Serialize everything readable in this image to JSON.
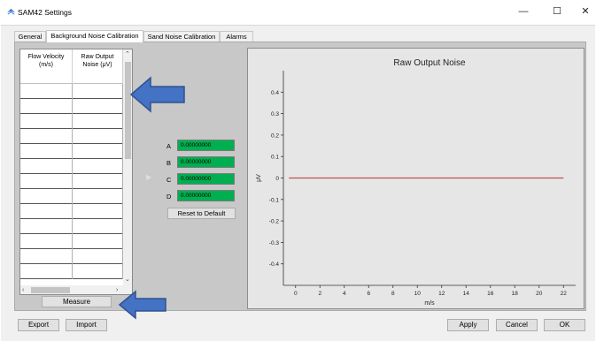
{
  "window": {
    "title": "SAM42 Settings",
    "minimize": "—",
    "maximize": "☐",
    "close": "✕"
  },
  "tabs": [
    "General",
    "Background Noise Calibration",
    "Sand Noise Calibration",
    "Alarms"
  ],
  "table": {
    "col1_header": "Flow Velocity (m/s)",
    "col2_header": "Raw Output Noise (μV)",
    "rows": [
      [
        "",
        ""
      ],
      [
        "",
        ""
      ],
      [
        "",
        ""
      ],
      [
        "",
        ""
      ],
      [
        "",
        ""
      ],
      [
        "",
        ""
      ],
      [
        "",
        ""
      ],
      [
        "",
        ""
      ],
      [
        "",
        ""
      ],
      [
        "",
        ""
      ],
      [
        "",
        ""
      ],
      [
        "",
        ""
      ],
      [
        "",
        ""
      ]
    ]
  },
  "measure_label": "Measure",
  "coefficients": [
    {
      "label": "A",
      "value": "0.00000000"
    },
    {
      "label": "B",
      "value": "0.00000000"
    },
    {
      "label": "C",
      "value": "0.00000000"
    },
    {
      "label": "D",
      "value": "0.00000000"
    }
  ],
  "reset_label": "Reset to Default",
  "footer": {
    "export": "Export",
    "import": "Import",
    "apply": "Apply",
    "cancel": "Cancel",
    "ok": "OK"
  },
  "colors": {
    "coef_fill": "#00b050",
    "line": "#c0504d",
    "annotation_arrow": "#4472c4"
  },
  "chart_data": {
    "type": "line",
    "title": "Raw Output Noise",
    "xlabel": "m/s",
    "ylabel": "μV",
    "xlim": [
      -1,
      23
    ],
    "ylim": [
      -0.5,
      0.5
    ],
    "xticks": [
      0,
      2,
      4,
      6,
      8,
      10,
      12,
      14,
      16,
      18,
      20,
      22
    ],
    "yticks": [
      -0.4,
      -0.3,
      -0.2,
      -0.1,
      0,
      0.1,
      0.2,
      0.3,
      0.4
    ],
    "series": [
      {
        "x": [
          -1,
          22
        ],
        "y": [
          0,
          0
        ]
      }
    ],
    "grid": false
  }
}
